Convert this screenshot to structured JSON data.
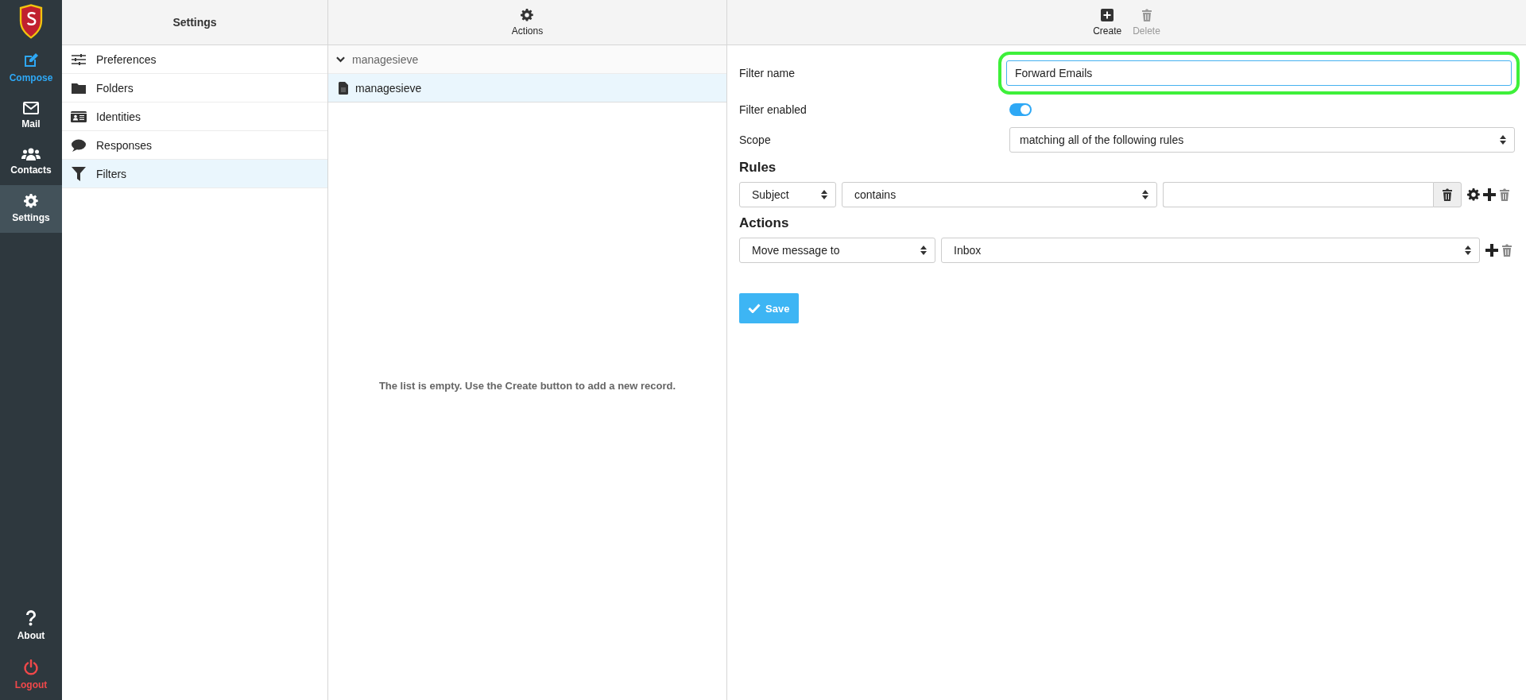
{
  "nav": {
    "items": [
      {
        "kind": "compose",
        "label": "Compose",
        "selected": false
      },
      {
        "kind": "mail",
        "label": "Mail",
        "selected": false
      },
      {
        "kind": "contacts",
        "label": "Contacts",
        "selected": false
      },
      {
        "kind": "settings",
        "label": "Settings",
        "selected": true
      }
    ],
    "bottom_items": [
      {
        "kind": "about",
        "label": "About"
      },
      {
        "kind": "logout",
        "label": "Logout"
      }
    ]
  },
  "settings": {
    "title": "Settings",
    "items": [
      {
        "kind": "preferences",
        "label": "Preferences",
        "selected": false
      },
      {
        "kind": "folders",
        "label": "Folders",
        "selected": false
      },
      {
        "kind": "identities",
        "label": "Identities",
        "selected": false
      },
      {
        "kind": "responses",
        "label": "Responses",
        "selected": false
      },
      {
        "kind": "filters",
        "label": "Filters",
        "selected": true
      }
    ]
  },
  "list": {
    "toolbar": {
      "label": "Actions"
    },
    "tree": [
      {
        "label": "managesieve",
        "expanded": true,
        "children": [
          {
            "label": "managesieve",
            "selected": true
          }
        ]
      }
    ],
    "empty_message": "The list is empty. Use the Create button to add a new record."
  },
  "editor": {
    "toolbar": [
      {
        "kind": "create",
        "label": "Create",
        "disabled": false
      },
      {
        "kind": "delete",
        "label": "Delete",
        "disabled": true
      }
    ],
    "filter_name": {
      "label": "Filter name",
      "value": "Forward Emails",
      "highlighted": true
    },
    "filter_enabled": {
      "label": "Filter enabled",
      "on": true
    },
    "scope": {
      "label": "Scope",
      "value": "matching all of the following rules"
    },
    "rules": {
      "title": "Rules",
      "rows": [
        {
          "field": "Subject",
          "operator": "contains"
        }
      ]
    },
    "actions": {
      "title": "Actions",
      "rows": [
        {
          "action": "Move message to",
          "target": "Inbox"
        }
      ]
    },
    "save": {
      "label": "Save"
    }
  }
}
